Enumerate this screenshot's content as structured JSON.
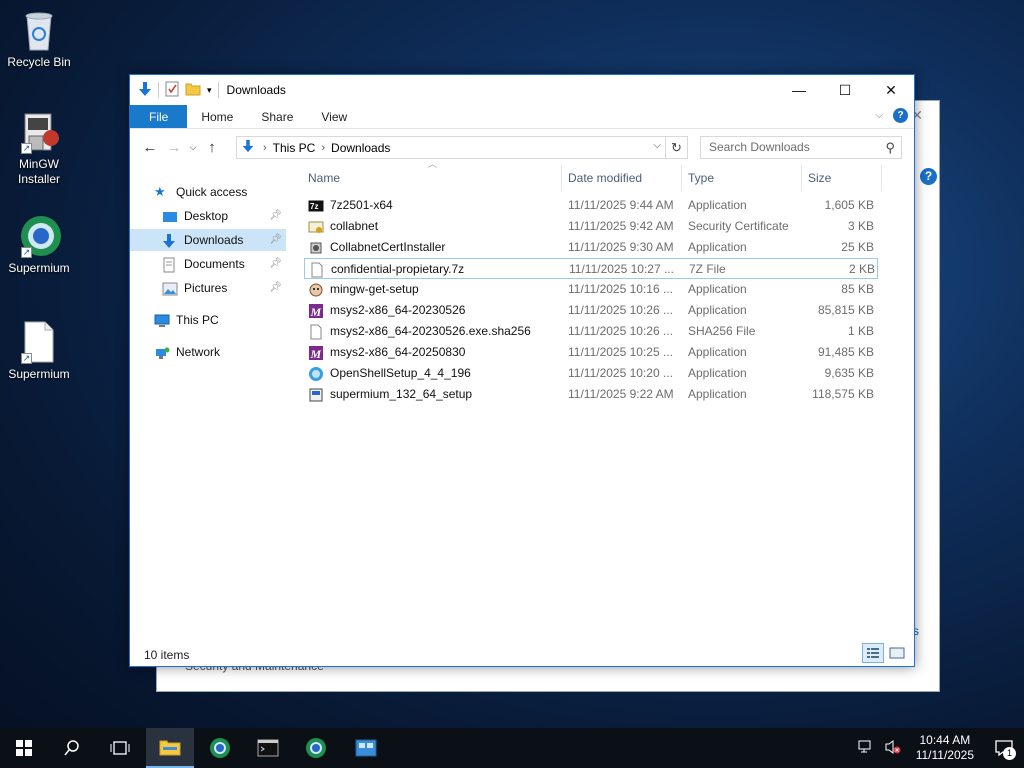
{
  "desktop": {
    "icons": [
      {
        "label": "Recycle Bin"
      },
      {
        "label": "MinGW Installer"
      },
      {
        "label": "Supermium"
      },
      {
        "label": "Supermium"
      }
    ]
  },
  "background_window": {
    "partial_text": "Security and Maintenance",
    "side_letter": "s"
  },
  "explorer": {
    "title": "Downloads",
    "tabs": [
      "File",
      "Home",
      "Share",
      "View"
    ],
    "address": {
      "crumbs": [
        "This PC",
        "Downloads"
      ]
    },
    "search_placeholder": "Search Downloads",
    "nav": {
      "quick_access": "Quick access",
      "items": [
        {
          "label": "Desktop",
          "pinned": true
        },
        {
          "label": "Downloads",
          "pinned": true,
          "selected": true
        },
        {
          "label": "Documents",
          "pinned": true
        },
        {
          "label": "Pictures",
          "pinned": true
        }
      ],
      "this_pc": "This PC",
      "network": "Network"
    },
    "columns": {
      "name": "Name",
      "date": "Date modified",
      "type": "Type",
      "size": "Size"
    },
    "files": [
      {
        "name": "7z2501-x64",
        "date": "11/11/2025 9:44 AM",
        "type": "Application",
        "size": "1,605 KB",
        "icon": "7zip-icon"
      },
      {
        "name": "collabnet",
        "date": "11/11/2025 9:42 AM",
        "type": "Security Certificate",
        "size": "3 KB",
        "icon": "certificate-icon"
      },
      {
        "name": "CollabnetCertInstaller",
        "date": "11/11/2025 9:30 AM",
        "type": "Application",
        "size": "25 KB",
        "icon": "installer-icon"
      },
      {
        "name": "confidential-propietary.7z",
        "date": "11/11/2025 10:27 ...",
        "type": "7Z File",
        "size": "2 KB",
        "icon": "blank-file-icon",
        "focused": true
      },
      {
        "name": "mingw-get-setup",
        "date": "11/11/2025 10:16 ...",
        "type": "Application",
        "size": "85 KB",
        "icon": "mingw-icon"
      },
      {
        "name": "msys2-x86_64-20230526",
        "date": "11/11/2025 10:26 ...",
        "type": "Application",
        "size": "85,815 KB",
        "icon": "msys2-icon"
      },
      {
        "name": "msys2-x86_64-20230526.exe.sha256",
        "date": "11/11/2025 10:26 ...",
        "type": "SHA256 File",
        "size": "1 KB",
        "icon": "blank-file-icon"
      },
      {
        "name": "msys2-x86_64-20250830",
        "date": "11/11/2025 10:25 ...",
        "type": "Application",
        "size": "91,485 KB",
        "icon": "msys2-icon"
      },
      {
        "name": "OpenShellSetup_4_4_196",
        "date": "11/11/2025 10:20 ...",
        "type": "Application",
        "size": "9,635 KB",
        "icon": "openshell-icon"
      },
      {
        "name": "supermium_132_64_setup",
        "date": "11/11/2025 9:22 AM",
        "type": "Application",
        "size": "118,575 KB",
        "icon": "setup-icon"
      }
    ],
    "status": "10 items"
  },
  "taskbar": {
    "time": "10:44 AM",
    "date": "11/11/2025",
    "notification_count": "1"
  },
  "colors": {
    "accent": "#1979ca",
    "selection": "#cce4f7",
    "msys2_purple": "#7a2a8a"
  }
}
